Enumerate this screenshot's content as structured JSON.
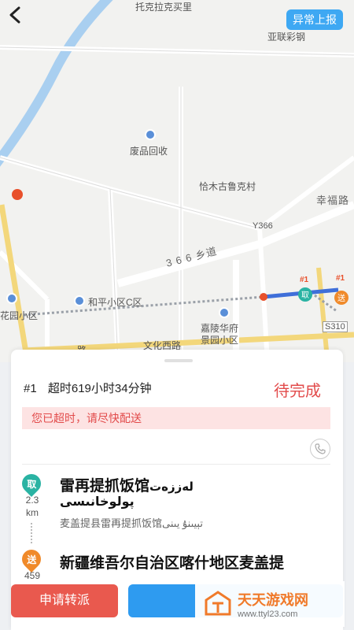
{
  "header": {
    "report_label": "异常上报"
  },
  "map": {
    "labels": {
      "top": "托克拉克买里",
      "steel": "亚联彩钢",
      "recycle": "废品回收",
      "village": "恰木古鲁克村",
      "road_code": "Y366",
      "road_xingfu": "幸福路",
      "road_366": "3 6 6 乡道",
      "heping": "和平小区C区",
      "garden": "花园小区",
      "jialing": "嘉陵华府",
      "jingyuan": "景园小区",
      "s310": "S310",
      "wenhua": "文化西路",
      "lu": "路",
      "badge1": "#1",
      "badge2": "#1"
    }
  },
  "order": {
    "number": "#1",
    "overtime": "超时619小时34分钟",
    "status": "待完成",
    "alert": "您已超时，请尽快配送"
  },
  "pickup": {
    "pin_label": "取",
    "distance_value": "2.3",
    "distance_unit": "km",
    "name": "雷再提抓饭馆",
    "name_ug_1": "لەززەت",
    "name_ug_2": "پولوخانىسى",
    "address": "麦盖提县雷再提抓饭馆",
    "address_ug": "تېيىنۇ يىنى"
  },
  "delivery": {
    "pin_label": "送",
    "distance_value": "459",
    "address": "新疆维吾尔自治区喀什地区麦盖提"
  },
  "buttons": {
    "transfer": "申请转派"
  },
  "watermark": {
    "title": "天天游戏网",
    "url": "www.ttyl23.com"
  }
}
